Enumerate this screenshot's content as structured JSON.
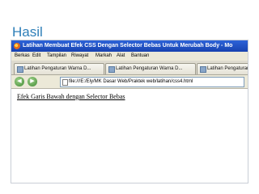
{
  "slide": {
    "title": "Hasil"
  },
  "window": {
    "title": "Latihan Membuat Efek CSS Dengan Selector Bebas Untuk Merubah Body - Mo"
  },
  "menu": {
    "items": [
      "Berkas",
      "Edit",
      "Tampilan",
      "Riwayat",
      "Markah",
      "Alat",
      "Bantuan"
    ]
  },
  "tabs": [
    {
      "label": "Latihan Pengaturan Warna D..."
    },
    {
      "label": "Latihan Pengaturan Warna D..."
    },
    {
      "label": "Latihan Pengaturan Warna D..."
    },
    {
      "label": "Latihan Pengah"
    }
  ],
  "nav": {
    "back": "◀",
    "forward": "▶",
    "url": "file:///E:/Ely/MK Dasar Web/Praktek web/latihan/css4.html"
  },
  "page": {
    "heading": "Efek Garis Bawah dengan Selector Bebas"
  },
  "colors": {
    "titlebar": "#2d63d8",
    "slide_title": "#2e7fb8",
    "chrome": "#ece9d8"
  },
  "icons": [
    "firefox-icon",
    "page-icon",
    "close-icon",
    "back-arrow-icon",
    "forward-arrow-icon"
  ]
}
